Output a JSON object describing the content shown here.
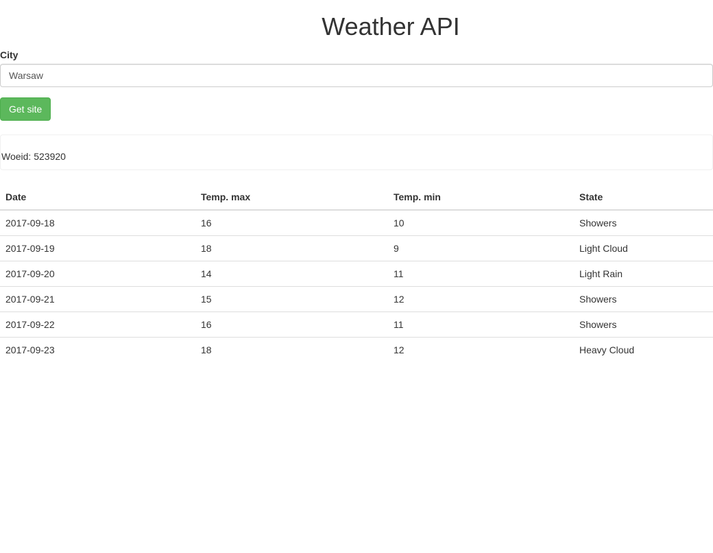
{
  "title": "Weather API",
  "form": {
    "city_label": "City",
    "city_value": "Warsaw",
    "submit_label": "Get site"
  },
  "woeid": "Woeid: 523920",
  "table": {
    "headers": [
      "Date",
      "Temp. max",
      "Temp. min",
      "State"
    ],
    "rows": [
      [
        "2017-09-18",
        "16",
        "10",
        "Showers"
      ],
      [
        "2017-09-19",
        "18",
        "9",
        "Light Cloud"
      ],
      [
        "2017-09-20",
        "14",
        "11",
        "Light Rain"
      ],
      [
        "2017-09-21",
        "15",
        "12",
        "Showers"
      ],
      [
        "2017-09-22",
        "16",
        "11",
        "Showers"
      ],
      [
        "2017-09-23",
        "18",
        "12",
        "Heavy Cloud"
      ]
    ]
  }
}
